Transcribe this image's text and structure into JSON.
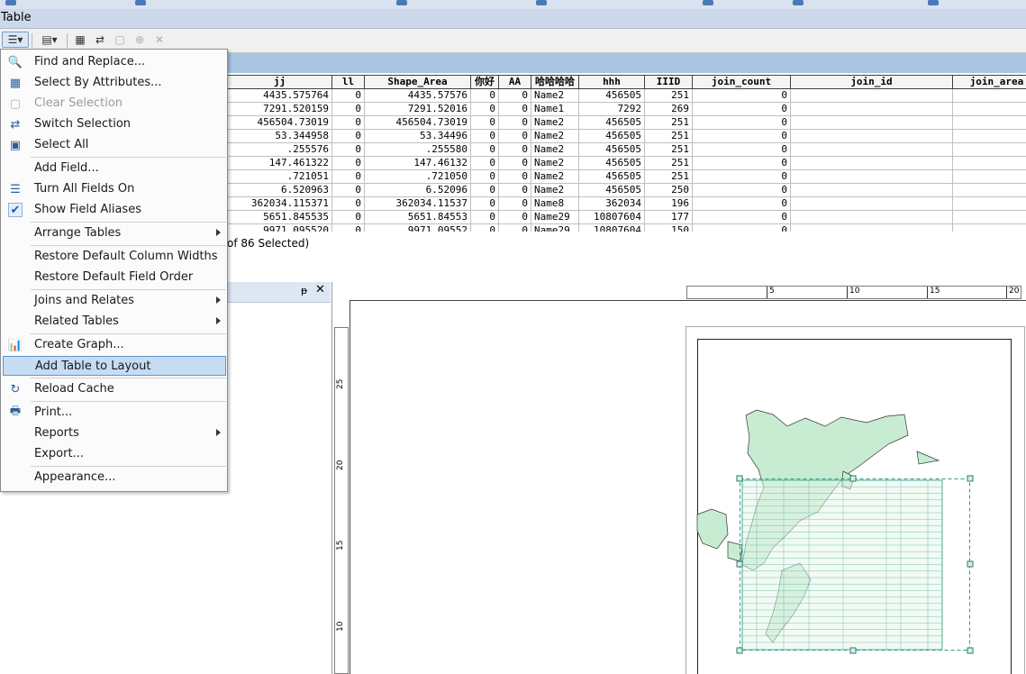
{
  "window": {
    "title": "Table"
  },
  "grid": {
    "columns": [
      {
        "label": "jj",
        "w": 117
      },
      {
        "label": "ll",
        "w": 36
      },
      {
        "label": "Shape_Area",
        "w": 118
      },
      {
        "label": "你好",
        "w": 31
      },
      {
        "label": "AA",
        "w": 36
      },
      {
        "label": "哈哈哈哈",
        "w": 53
      },
      {
        "label": "hhh",
        "w": 73
      },
      {
        "label": "IIID",
        "w": 53
      },
      {
        "label": "join_count",
        "w": 109
      },
      {
        "label": "join_id",
        "w": 180
      },
      {
        "label": "join_area",
        "w": 98
      }
    ],
    "rows": [
      [
        "4435.575764",
        "0",
        "4435.57576",
        "0",
        "0",
        "Name2",
        "456505",
        "251",
        "0",
        "",
        ""
      ],
      [
        "7291.520159",
        "0",
        "7291.52016",
        "0",
        "0",
        "Name1",
        "7292",
        "269",
        "0",
        "",
        ""
      ],
      [
        "456504.73019",
        "0",
        "456504.73019",
        "0",
        "0",
        "Name2",
        "456505",
        "251",
        "0",
        "",
        ""
      ],
      [
        "53.344958",
        "0",
        "53.34496",
        "0",
        "0",
        "Name2",
        "456505",
        "251",
        "0",
        "",
        ""
      ],
      [
        ".255576",
        "0",
        ".255580",
        "0",
        "0",
        "Name2",
        "456505",
        "251",
        "0",
        "",
        ""
      ],
      [
        "147.461322",
        "0",
        "147.46132",
        "0",
        "0",
        "Name2",
        "456505",
        "251",
        "0",
        "",
        ""
      ],
      [
        ".721051",
        "0",
        ".721050",
        "0",
        "0",
        "Name2",
        "456505",
        "251",
        "0",
        "",
        ""
      ],
      [
        "6.520963",
        "0",
        "6.52096",
        "0",
        "0",
        "Name2",
        "456505",
        "250",
        "0",
        "",
        ""
      ],
      [
        "362034.115371",
        "0",
        "362034.11537",
        "0",
        "0",
        "Name8",
        "362034",
        "196",
        "0",
        "",
        ""
      ],
      [
        "5651.845535",
        "0",
        "5651.84553",
        "0",
        "0",
        "Name29",
        "10807604",
        "177",
        "0",
        "",
        ""
      ],
      [
        "9971.095520",
        "0",
        "9971.09552",
        "0",
        "0",
        "Name29",
        "10807604",
        "150",
        "0",
        "",
        ""
      ]
    ]
  },
  "status": {
    "text": "of 86 Selected)"
  },
  "ruler": {
    "h_labels": [
      "5",
      "10",
      "15",
      "20"
    ],
    "v_labels": [
      "25",
      "20",
      "15",
      "10"
    ]
  },
  "menu": {
    "items": [
      {
        "id": "find-replace",
        "label": "Find and Replace...",
        "icon": "binoculars-icon",
        "glyph": "🔍"
      },
      {
        "id": "select-by-attributes",
        "label": "Select By Attributes...",
        "icon": "select-attributes-icon",
        "glyph": "▦"
      },
      {
        "id": "clear-selection",
        "label": "Clear Selection",
        "icon": "clear-selection-icon",
        "glyph": "▢",
        "disabled": true
      },
      {
        "id": "switch-selection",
        "label": "Switch Selection",
        "icon": "switch-selection-icon",
        "glyph": "⇄"
      },
      {
        "id": "select-all",
        "label": "Select All",
        "icon": "select-all-icon",
        "glyph": "▣"
      },
      {
        "id": "add-field",
        "label": "Add Field..."
      },
      {
        "id": "turn-all-fields-on",
        "label": "Turn All Fields On",
        "icon": "fields-list-icon",
        "glyph": "☰"
      },
      {
        "id": "show-field-aliases",
        "label": "Show Field Aliases",
        "icon": "checkmark-icon",
        "glyph": "✔",
        "checked": true
      },
      {
        "id": "arrange-tables",
        "label": "Arrange Tables",
        "submenu": true
      },
      {
        "id": "restore-column-widths",
        "label": "Restore Default Column Widths"
      },
      {
        "id": "restore-field-order",
        "label": "Restore Default Field Order"
      },
      {
        "id": "joins-relates",
        "label": "Joins and Relates",
        "submenu": true
      },
      {
        "id": "related-tables",
        "label": "Related Tables",
        "submenu": true
      },
      {
        "id": "create-graph",
        "label": "Create Graph...",
        "icon": "bar-chart-icon",
        "glyph": "📊"
      },
      {
        "id": "add-table-to-layout",
        "label": "Add Table to Layout",
        "highlighted": true
      },
      {
        "id": "reload-cache",
        "label": "Reload Cache",
        "icon": "refresh-icon",
        "glyph": "↻"
      },
      {
        "id": "print",
        "label": "Print...",
        "icon": "printer-icon",
        "glyph": "🖶"
      },
      {
        "id": "reports",
        "label": "Reports",
        "submenu": true
      },
      {
        "id": "export",
        "label": "Export..."
      },
      {
        "id": "appearance",
        "label": "Appearance..."
      }
    ]
  },
  "colors": {
    "highlight": "#c5dcf3",
    "map_fill": "#c8ecd2",
    "selection": "#2f9a8a"
  }
}
